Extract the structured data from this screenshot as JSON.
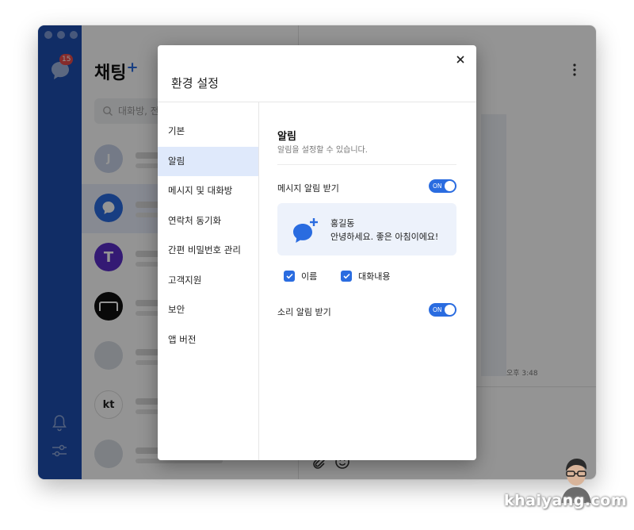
{
  "app": {
    "title": "채팅",
    "title_mark": "+",
    "badge_count": "15",
    "search_placeholder": "대화방, 전체"
  },
  "chat": {
    "time": "오후 3:48"
  },
  "modal": {
    "title": "환경 설정",
    "close_icon": "close-icon",
    "nav": [
      {
        "label": "기본"
      },
      {
        "label": "알림",
        "active": true
      },
      {
        "label": "메시지 및 대화방"
      },
      {
        "label": "연락처 동기화"
      },
      {
        "label": "간편 비밀번호 관리"
      },
      {
        "label": "고객지원"
      },
      {
        "label": "보안"
      },
      {
        "label": "앱 버전"
      }
    ],
    "section": {
      "title": "알림",
      "description": "알림을 설정할 수 있습니다.",
      "message_alert_label": "메시지 알림 받기",
      "message_alert_state": "ON",
      "preview_name": "홍길동",
      "preview_message": "안녕하세요. 좋은 아침이에요!",
      "checkbox_name": "이름",
      "checkbox_content": "대화내용",
      "sound_alert_label": "소리 알림 받기",
      "sound_alert_state": "ON"
    }
  },
  "colors": {
    "accent": "#2a6ce0",
    "rail": "#1e4fb0",
    "active_nav": "#dfe9fb",
    "preview_bg": "#edf2fb"
  },
  "watermark": "khaiyang.com"
}
